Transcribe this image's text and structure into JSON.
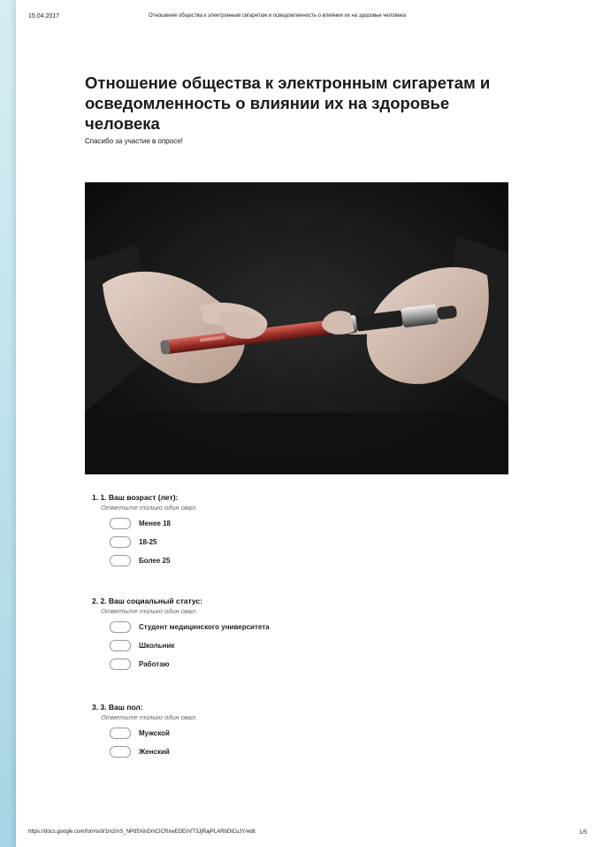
{
  "header": {
    "date": "15.04.2017",
    "title": "Отношение общества к электронным сигаретам и осведомленность о влиянии их на здоровье человека"
  },
  "form": {
    "title": "Отношение общества к электронным сигаретам и осведомленность о влиянии их на здоровье человека",
    "description": "Спасибо за участие в опросе!"
  },
  "questions": [
    {
      "title": "1. 1. Ваш возраст (лет):",
      "hint": "Отметьте только один овал.",
      "options": [
        "Менее 18",
        "18-25",
        "Более 25"
      ]
    },
    {
      "title": "2. 2. Ваш социальный статус:",
      "hint": "Отметьте только один овал.",
      "options": [
        "Студент медицинского университета",
        "Школьник",
        "Работаю"
      ]
    },
    {
      "title": "3. 3. Ваш пол:",
      "hint": "Отметьте только один овал.",
      "options": [
        "Мужской",
        "Женский"
      ]
    }
  ],
  "footer": {
    "url": "https://docs.google.com/forms/d/1m2mS_NPd5XinDmCICRxwEDEnVT3JjRajPLARbDICuJY/edit",
    "page": "1/5"
  }
}
